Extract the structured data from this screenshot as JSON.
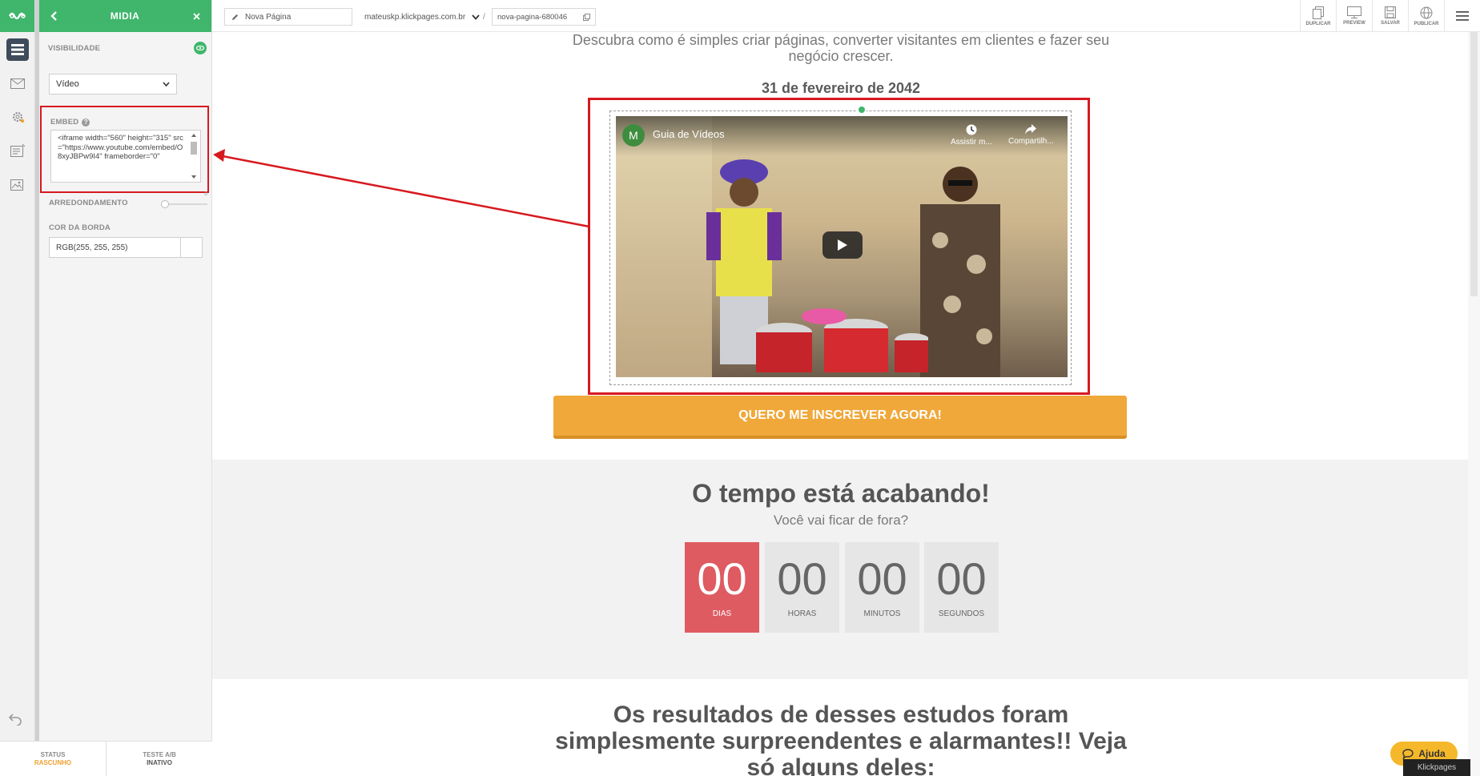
{
  "panel": {
    "title": "MIDIA",
    "visibility_label": "VISIBILIDADE",
    "type_select": "Vídeo",
    "embed_label": "EMBED",
    "embed_code": "<iframe width=\"560\" height=\"315\" src=\"https://www.youtube.com/embed/O8xyJBPw9I4\" frameborder=\"0\"",
    "rounding_label": "ARREDONDAMENTO",
    "rounding_value": "0",
    "border_color_label": "COR DA BORDA",
    "border_color_value": "RGB(255, 255, 255)"
  },
  "bottom_bar": {
    "status_label": "STATUS",
    "status_value": "RASCUNHO",
    "ab_label": "TESTE A/B",
    "ab_value": "INATIVO"
  },
  "topbar": {
    "page_name": "Nova Página",
    "domain": "mateuskp.klickpages.com.br",
    "separator": "/",
    "slug": "nova-pagina-680046",
    "actions": {
      "duplicate": "DUPLICAR",
      "preview": "PREVIEW",
      "save": "SALVAR",
      "publish": "PUBLICAR"
    }
  },
  "page": {
    "subtitle": "Descubra como é simples criar páginas, converter visitantes em clientes e fazer seu negócio crescer.",
    "date": "31 de fevereiro de 2042",
    "video": {
      "channel_initial": "M",
      "channel_title": "Guia de Vídeos",
      "watch_later": "Assistir m...",
      "share": "Compartilh..."
    },
    "cta": "QUERO ME INSCREVER AGORA!",
    "countdown": {
      "title": "O tempo está acabando!",
      "subtitle": "Você vai ficar de fora?",
      "units": [
        {
          "value": "00",
          "label": "DIAS"
        },
        {
          "value": "00",
          "label": "HORAS"
        },
        {
          "value": "00",
          "label": "MINUTOS"
        },
        {
          "value": "00",
          "label": "SEGUNDOS"
        }
      ]
    },
    "results_heading": "Os resultados de desses estudos foram simplesmente surpreendentes e alarmantes!! Veja só alguns deles:"
  },
  "help_button": "Ajuda",
  "watermark": "Klickpages",
  "colors": {
    "brand_green": "#3fb66b",
    "annotation_red": "#d7191f",
    "cta_orange": "#f0a83a",
    "countdown_red": "#de5b61"
  }
}
